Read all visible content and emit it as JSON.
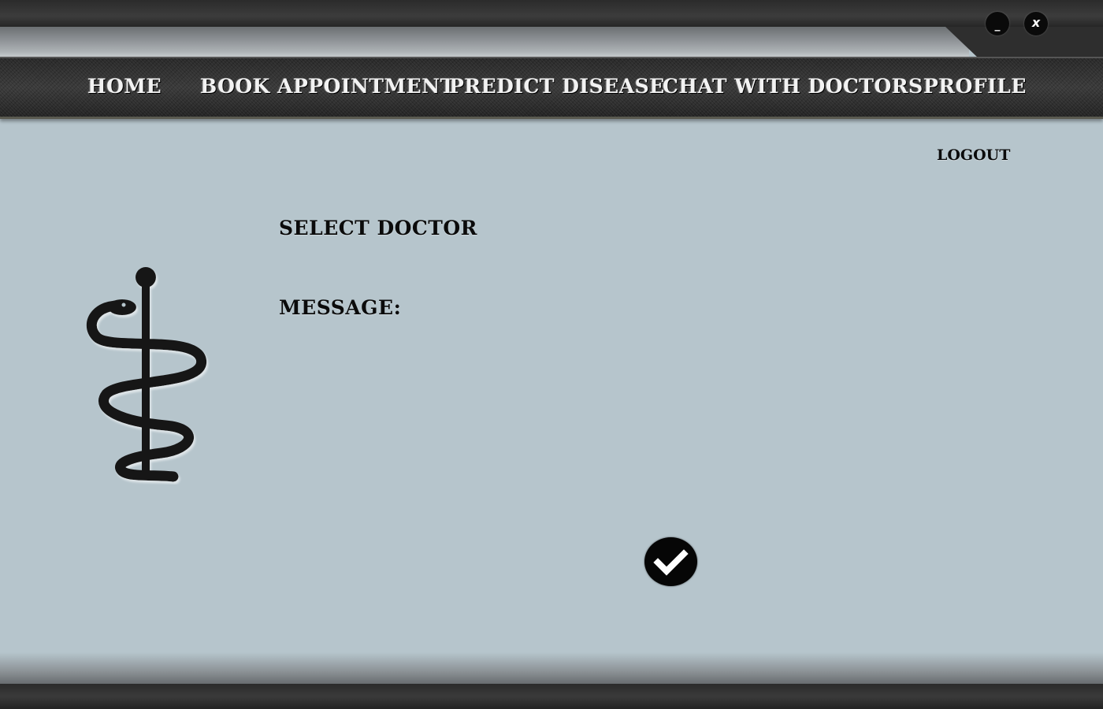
{
  "window_controls": {
    "minimize_label": "_",
    "close_label": "x"
  },
  "nav": {
    "items": [
      {
        "label": "HOME"
      },
      {
        "label": "BOOK APPOINTMENT"
      },
      {
        "label": "PREDICT DISEASE"
      },
      {
        "label": "CHAT WITH DOCTORS"
      },
      {
        "label": "PROFILE"
      }
    ]
  },
  "header": {
    "logout_label": "LOGOUT"
  },
  "form": {
    "select_doctor_label": "SELECT DOCTOR",
    "message_label": "MESSAGE:",
    "submit_icon": "checkmark-icon"
  },
  "logo": {
    "icon": "rod-of-asclepius-icon"
  },
  "colors": {
    "background": "#b6c5cc",
    "bar_dark": "#2b2b2b",
    "nav_text": "#f2f2f2",
    "label_text": "#0b0b0b"
  }
}
